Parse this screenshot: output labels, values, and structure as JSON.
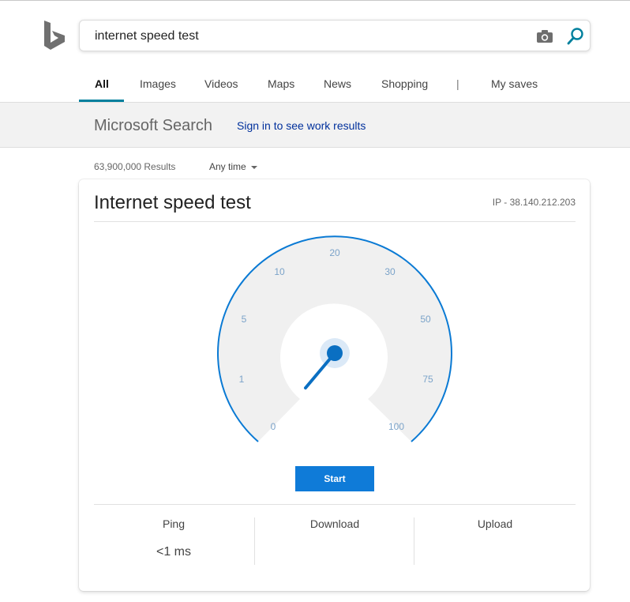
{
  "search": {
    "query": "internet speed test"
  },
  "tabs": [
    {
      "label": "All",
      "active": true
    },
    {
      "label": "Images"
    },
    {
      "label": "Videos"
    },
    {
      "label": "Maps"
    },
    {
      "label": "News"
    },
    {
      "label": "Shopping"
    },
    {
      "label": "|"
    },
    {
      "label": "My saves"
    }
  ],
  "ms_search": {
    "title": "Microsoft Search",
    "signin": "Sign in to see work results"
  },
  "results": {
    "count": "63,900,000 Results",
    "filter": "Any time"
  },
  "speedtest": {
    "title": "Internet speed test",
    "ip": "IP - 38.140.212.203",
    "gauge_labels": [
      "0",
      "1",
      "5",
      "10",
      "20",
      "30",
      "50",
      "75",
      "100"
    ],
    "start_label": "Start",
    "stats": [
      {
        "label": "Ping",
        "value": "<1 ms"
      },
      {
        "label": "Download",
        "value": ""
      },
      {
        "label": "Upload",
        "value": ""
      }
    ]
  },
  "colors": {
    "accent": "#0f7bd8",
    "gauge_fill": "#f0f0f0",
    "tick_text": "#7ba3c9"
  },
  "icons": {
    "logo": "bing-logo",
    "camera": "camera-icon",
    "search": "search-icon"
  }
}
